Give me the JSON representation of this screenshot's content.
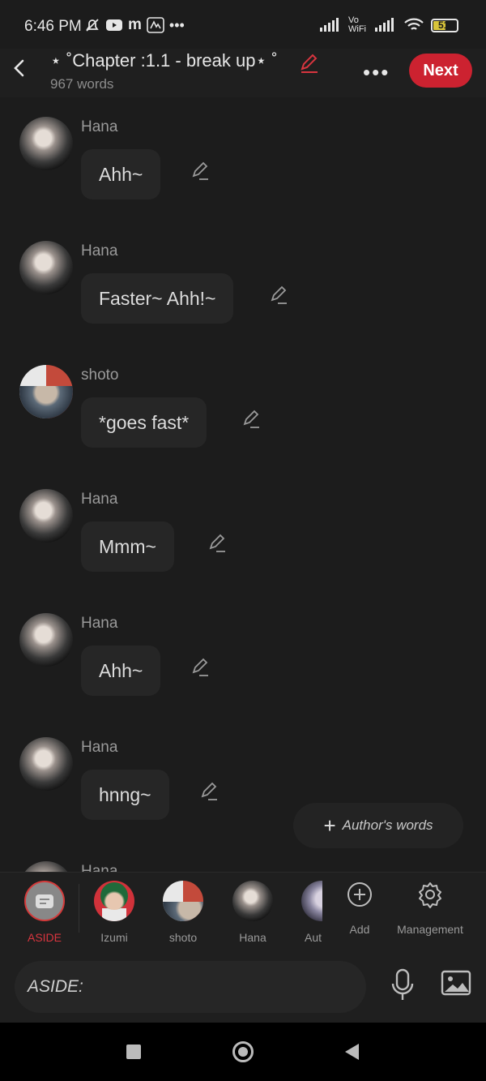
{
  "status_bar": {
    "time": "6:46 PM",
    "network_label": "Vo WiFi",
    "battery": "51"
  },
  "header": {
    "title": "⋆ ˚Chapter :1.1 - break up⋆ ˚",
    "word_count": "967 words",
    "next_label": "Next",
    "more_label": "•••",
    "accent_color": "#cc2230"
  },
  "messages": [
    {
      "name": "Hana",
      "text": "Ahh~"
    },
    {
      "name": "Hana",
      "text": "Faster~ Ahh!~"
    },
    {
      "name": "shoto",
      "text": "*goes fast*"
    },
    {
      "name": "Hana",
      "text": "Mmm~"
    },
    {
      "name": "Hana",
      "text": "Ahh~"
    },
    {
      "name": "Hana",
      "text": "hnng~"
    },
    {
      "name": "Hana",
      "text": ""
    }
  ],
  "authors_words": {
    "plus": "+",
    "label": "Author's words"
  },
  "characters": [
    {
      "label": "ASIDE",
      "color": "#d43a3a"
    },
    {
      "label": "Izumi"
    },
    {
      "label": "shoto"
    },
    {
      "label": "Hana"
    },
    {
      "label": "Aut"
    },
    {
      "label": "Add"
    },
    {
      "label": "Management"
    }
  ],
  "input": {
    "placeholder": "ASIDE:"
  }
}
